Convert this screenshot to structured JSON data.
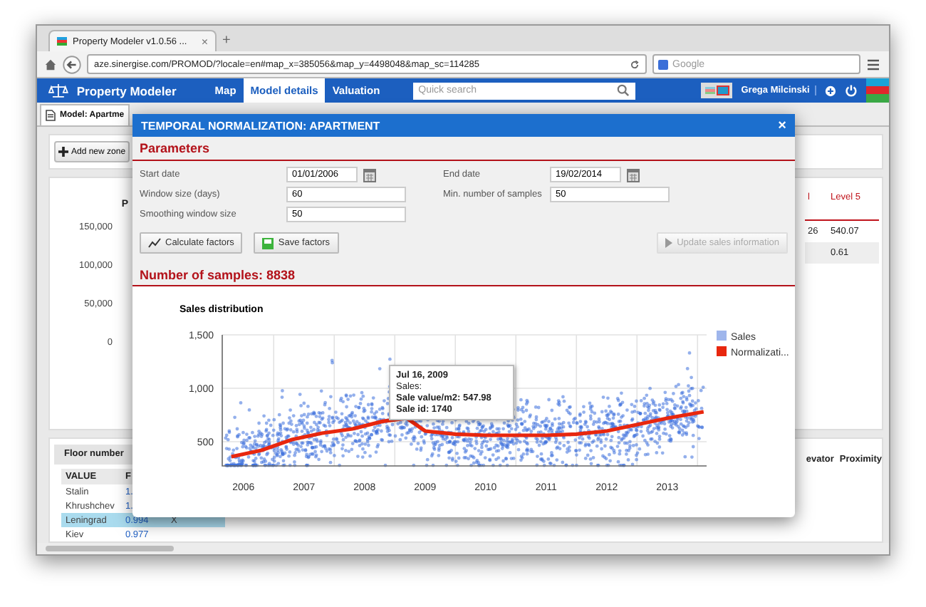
{
  "browser": {
    "tab_title": "Property Modeler v1.0.56 ...",
    "tab_close": "×",
    "new_tab": "+",
    "url": "aze.sinergise.com/PROMOD/?locale=en#map_x=385056&map_y=4498048&map_sc=114285",
    "search_placeholder": "Google"
  },
  "app_bar": {
    "title": "Property Modeler",
    "nav": [
      {
        "label": "Map",
        "selected": false
      },
      {
        "label": "Model details",
        "selected": true
      },
      {
        "label": "Valuation",
        "selected": false
      }
    ],
    "search_placeholder": "Quick search",
    "user": "Grega Milcinski"
  },
  "page_tabs": [
    {
      "label": "Model: Apartme",
      "selected": true
    }
  ],
  "toolbar": {
    "add_button": "Add new zone"
  },
  "left_chart": {
    "title": "P",
    "y_labels": [
      "150,000",
      "100,000",
      "50,000",
      "0"
    ]
  },
  "right_table": {
    "columns": [
      "l",
      "Level 5"
    ],
    "rows": [
      {
        "column_1": "26",
        "level_5": "540.07"
      },
      {
        "level_5": "0.61"
      }
    ]
  },
  "floor_panel": {
    "title": "Floor number",
    "columns": [
      "VALUE",
      "F"
    ],
    "rows": [
      {
        "value": "Stalin",
        "column_2": "1.",
        "selected": false
      },
      {
        "value": "Khrushchev",
        "column_2": "1.",
        "selected": false
      },
      {
        "value": "Leningrad",
        "column_2": "0.994",
        "action": "X",
        "selected": true
      },
      {
        "value": "Kiev",
        "column_2": "0.977",
        "selected": false
      }
    ]
  },
  "right_columns": [
    "evator",
    "Proximity"
  ],
  "dialog": {
    "title": "TEMPORAL NORMALIZATION: APARTMENT",
    "close": "×",
    "section_title": "Parameters",
    "fields": [
      {
        "label": "Start date",
        "value": "01/01/2006",
        "kind": "date"
      },
      {
        "label": "End date",
        "value": "19/02/2014",
        "kind": "date"
      },
      {
        "label": "Window size (days)",
        "value": "60",
        "kind": "text"
      },
      {
        "label": "Min. number of samples",
        "value": "50",
        "kind": "text"
      },
      {
        "label": "Smoothing window size",
        "value": "50",
        "kind": "text"
      }
    ],
    "buttons": [
      {
        "label": "Calculate factors",
        "kind": "chart",
        "disabled": false
      },
      {
        "label": "Save factors",
        "kind": "save",
        "disabled": false
      },
      {
        "label": "Update sales information",
        "kind": "play",
        "disabled": true
      }
    ],
    "samples_heading": "Number of samples: 8838",
    "chart": {
      "legend": [
        {
          "label": "Sales",
          "color": "#9fb6ec"
        }
      ],
      "tooltip": {
        "date": "Jul 16, 2009",
        "series": "Sales:",
        "lines": [
          "Sale value/m2: 547.98",
          "Sale id: 1740"
        ]
      },
      "chart_data": {
        "type": "line",
        "title": "Sales distribution",
        "x": [
          2005.8,
          2006.3,
          2006.8,
          2007.3,
          2007.8,
          2008.3,
          2008.7,
          2009.0,
          2009.5,
          2010.0,
          2010.5,
          2011.0,
          2011.5,
          2012.0,
          2012.5,
          2013.0,
          2013.6
        ],
        "series": [
          {
            "name": "Normalizati...",
            "color": "#e8270e",
            "values": [
              360,
              420,
              520,
              580,
              620,
              690,
              720,
              600,
              570,
              560,
              560,
              560,
              570,
              600,
              660,
              720,
              780
            ]
          }
        ],
        "xlim": [
          2005.65,
          2013.65
        ],
        "ylim": [
          273,
          1500
        ],
        "xticks": [
          2006,
          2007,
          2008,
          2009,
          2010,
          2011,
          2012,
          2013
        ],
        "yticks": [
          500,
          {
            "value": 1000,
            "label": "1,000"
          },
          {
            "value": 1500,
            "label": "1,500"
          }
        ]
      }
    }
  }
}
